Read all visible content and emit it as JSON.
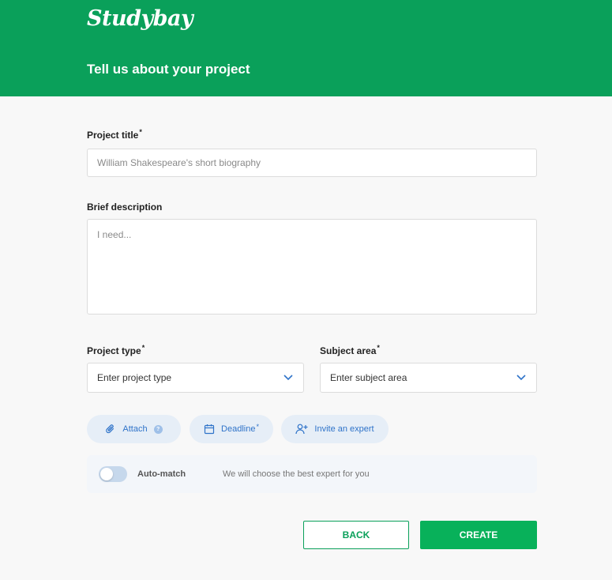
{
  "header": {
    "logo": "Studybay",
    "title": "Tell us about your project"
  },
  "form": {
    "project_title": {
      "label": "Project title",
      "required_mark": "*",
      "placeholder": "William Shakespeare's short biography"
    },
    "description": {
      "label": "Brief description",
      "placeholder": "I need..."
    },
    "project_type": {
      "label": "Project type",
      "required_mark": "*",
      "value": "Enter project type"
    },
    "subject_area": {
      "label": "Subject area",
      "required_mark": "*",
      "value": "Enter subject area"
    }
  },
  "actions": {
    "attach": {
      "label": "Attach",
      "help": "?"
    },
    "deadline": {
      "label": "Deadline",
      "required_mark": "*"
    },
    "invite": {
      "label": "Invite an expert"
    }
  },
  "automatch": {
    "label": "Auto-match",
    "description": "We will choose the best expert for you",
    "enabled": false
  },
  "buttons": {
    "back": "BACK",
    "create": "CREATE"
  },
  "colors": {
    "brand_green": "#0aa05a",
    "create_green": "#08b15a",
    "action_blue": "#2f73c9",
    "pill_bg": "#e6eef7"
  },
  "icons": {
    "attach": "paperclip-icon",
    "deadline": "calendar-icon",
    "invite": "add-user-icon",
    "dropdown": "chevron-down-icon"
  }
}
